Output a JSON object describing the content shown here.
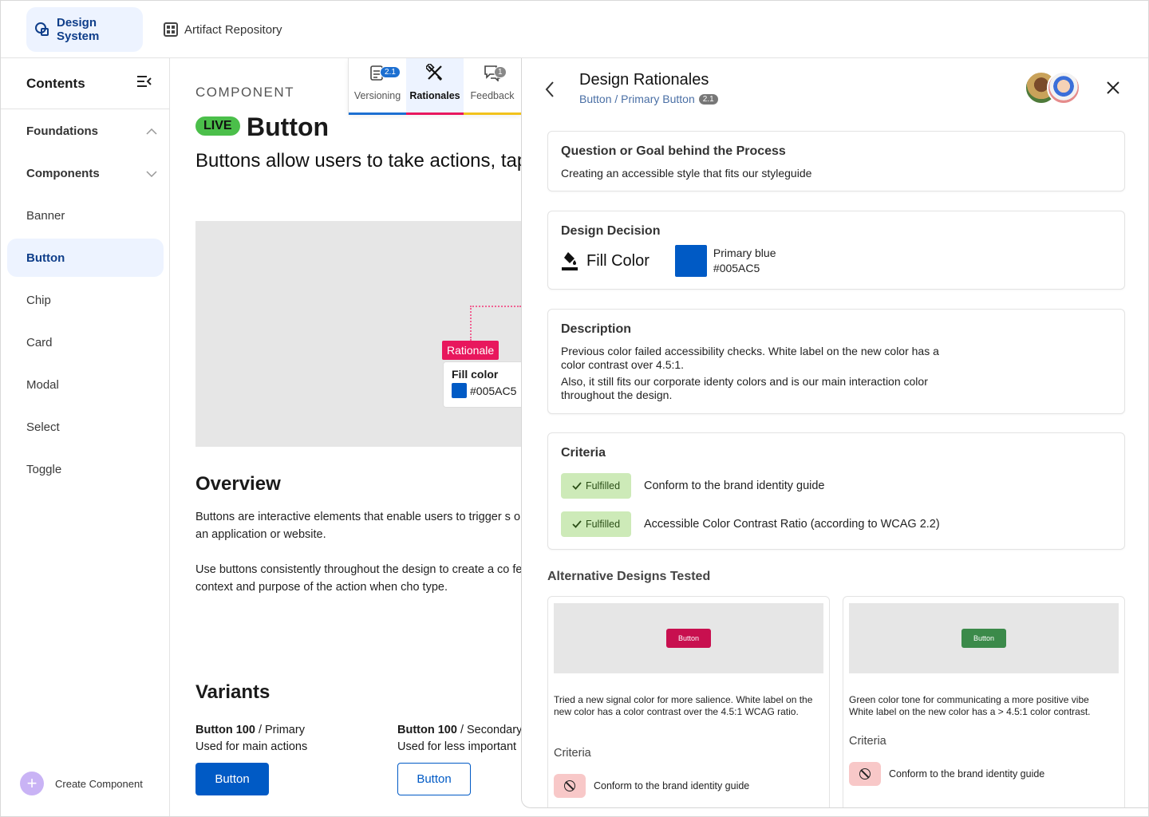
{
  "topbar": {
    "tabs": [
      {
        "label": "Design System",
        "icon": "design-system-icon",
        "active": true
      },
      {
        "label": "Artifact Repository",
        "icon": "grid-icon",
        "active": false
      }
    ]
  },
  "sidebar": {
    "title": "Contents",
    "items": [
      {
        "label": "Foundations",
        "type": "group",
        "expanded": true
      },
      {
        "label": "Components",
        "type": "group",
        "expanded": false
      },
      {
        "label": "Banner"
      },
      {
        "label": "Button",
        "selected": true
      },
      {
        "label": "Chip"
      },
      {
        "label": "Card"
      },
      {
        "label": "Modal"
      },
      {
        "label": "Select"
      },
      {
        "label": "Toggle"
      }
    ],
    "create_label": "Create Component"
  },
  "main": {
    "eyebrow": "COMPONENT",
    "status": "LIVE",
    "title": "Button",
    "lede": "Buttons allow users to take actions, tap.",
    "rationale_tag": "Rationale",
    "rationale_label": "Fill color",
    "rationale_value": "#005AC5",
    "overview_heading": "Overview",
    "overview_p1": "Buttons are interactive elements that enable users to trigger s or functions within an application or website.",
    "overview_p2": "Use buttons consistently throughout the design to create a co feel. Consider the context and purpose of the action when cho type.",
    "variants_heading": "Variants",
    "variants": [
      {
        "name": "Button 100",
        "kind": " / Primary",
        "desc": "Used for main actions",
        "button": "Button"
      },
      {
        "name": "Button 100",
        "kind": " / Secondary",
        "desc": "Used for less important",
        "button": "Button"
      }
    ]
  },
  "tabs": [
    {
      "label": "Versioning",
      "badge": "2.1",
      "icon": "versioning-icon"
    },
    {
      "label": "Rationales",
      "badge": "",
      "icon": "rationales-icon"
    },
    {
      "label": "Feedback",
      "badge": "1",
      "icon": "feedback-icon"
    }
  ],
  "panel": {
    "title": "Design Rationales",
    "subtitle": "Button / Primary Button",
    "version": "2.1",
    "question": {
      "heading": "Question or Goal behind the Process",
      "text": "Creating an accessible style that fits our styleguide"
    },
    "decision": {
      "heading": "Design Decision",
      "label": "Fill Color",
      "color_name": "Primary blue",
      "color_hex": "#005AC5"
    },
    "description": {
      "heading": "Description",
      "p1": "Previous color failed accessibility checks. White label on the new color has a color contrast over 4.5:1.",
      "p2": "Also, it still fits our corporate identy colors and is our main interaction color throughout the design."
    },
    "criteria": {
      "heading": "Criteria",
      "items": [
        {
          "status": "Fulfilled",
          "text": "Conform to the brand identity guide"
        },
        {
          "status": "Fulfilled",
          "text": "Accessible Color Contrast Ratio (according to WCAG 2.2)"
        }
      ]
    },
    "alternatives": {
      "heading": "Alternative Designs Tested",
      "items": [
        {
          "button": "Button",
          "button_color": "#c8104f",
          "desc": "Tried a new signal color for more salience. White label on the new color has a color contrast over the 4.5:1 WCAG ratio.",
          "criteria_heading": "Criteria",
          "criteria_text": "Conform to the brand identity guide"
        },
        {
          "button": "Button",
          "button_color": "#3b8a4a",
          "desc": "Green color tone for communicating a more positive vibe White label on the new color has a > 4.5:1 color contrast.",
          "criteria_heading": "Criteria",
          "criteria_text": "Conform to the brand identity guide"
        }
      ]
    }
  }
}
